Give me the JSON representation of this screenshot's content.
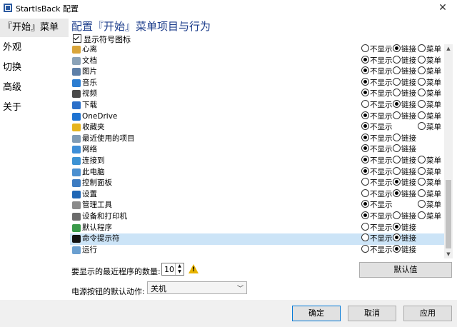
{
  "window": {
    "title": "StartIsBack 配置",
    "close": "✕"
  },
  "sidebar": {
    "items": [
      {
        "label": "『开始』菜单",
        "active": true
      },
      {
        "label": "外观",
        "active": false
      },
      {
        "label": "切换",
        "active": false
      },
      {
        "label": "高级",
        "active": false
      },
      {
        "label": "关于",
        "active": false
      }
    ]
  },
  "main": {
    "heading": "配置『开始』菜单项目与行为",
    "show_icons_label": "显示符号图标",
    "option_labels": {
      "hide": "不显示",
      "link": "链接",
      "menu": "菜单"
    },
    "items": [
      {
        "label": "心离",
        "icon": "user-icon",
        "color": "#d9a53a",
        "options": [
          "hide",
          "link",
          "menu"
        ],
        "selected": "link"
      },
      {
        "label": "文档",
        "icon": "documents-icon",
        "color": "#8aa2b8",
        "options": [
          "hide",
          "link",
          "menu"
        ],
        "selected": "hide"
      },
      {
        "label": "图片",
        "icon": "pictures-icon",
        "color": "#5d7fa8",
        "options": [
          "hide",
          "link",
          "menu"
        ],
        "selected": "hide"
      },
      {
        "label": "音乐",
        "icon": "music-icon",
        "color": "#2b7dd1",
        "options": [
          "hide",
          "link",
          "menu"
        ],
        "selected": "hide"
      },
      {
        "label": "视频",
        "icon": "video-icon",
        "color": "#4a4a4a",
        "options": [
          "hide",
          "link",
          "menu"
        ],
        "selected": "hide"
      },
      {
        "label": "下载",
        "icon": "download-icon",
        "color": "#2a6fc9",
        "options": [
          "hide",
          "link",
          "menu"
        ],
        "selected": "link"
      },
      {
        "label": "OneDrive",
        "icon": "onedrive-icon",
        "color": "#1e73d2",
        "options": [
          "hide",
          "link",
          "menu"
        ],
        "selected": "hide"
      },
      {
        "label": "收藏夹",
        "icon": "favorites-icon",
        "color": "#e6b41e",
        "options": [
          "hide",
          "menu"
        ],
        "selected": "hide"
      },
      {
        "label": "最近使用的项目",
        "icon": "recent-items-icon",
        "color": "#7f9bb5",
        "options": [
          "hide",
          "link"
        ],
        "selected": "hide"
      },
      {
        "label": "网络",
        "icon": "network-icon",
        "color": "#3d8ed8",
        "options": [
          "hide",
          "link"
        ],
        "selected": "hide"
      },
      {
        "label": "连接到",
        "icon": "connect-to-icon",
        "color": "#3c92d4",
        "options": [
          "hide",
          "link",
          "menu"
        ],
        "selected": "hide"
      },
      {
        "label": "此电脑",
        "icon": "this-pc-icon",
        "color": "#4a8fd0",
        "options": [
          "hide",
          "link",
          "menu"
        ],
        "selected": "hide"
      },
      {
        "label": "控制面板",
        "icon": "control-panel-icon",
        "color": "#3d7cc2",
        "options": [
          "hide",
          "link",
          "menu"
        ],
        "selected": "link"
      },
      {
        "label": "设置",
        "icon": "settings-icon",
        "color": "#1f66b5",
        "options": [
          "hide",
          "link",
          "menu"
        ],
        "selected": "link"
      },
      {
        "label": "管理工具",
        "icon": "admin-tools-icon",
        "color": "#8a8a8a",
        "options": [
          "hide",
          "menu"
        ],
        "selected": "hide"
      },
      {
        "label": "设备和打印机",
        "icon": "printer-icon",
        "color": "#6b6b6b",
        "options": [
          "hide",
          "link",
          "menu"
        ],
        "selected": "hide"
      },
      {
        "label": "默认程序",
        "icon": "default-programs-icon",
        "color": "#3a9a4a",
        "options": [
          "hide",
          "link"
        ],
        "selected": "link"
      },
      {
        "label": "命令提示符",
        "icon": "cmd-icon",
        "color": "#111111",
        "options": [
          "hide",
          "link"
        ],
        "selected": "link",
        "highlight": true
      },
      {
        "label": "运行",
        "icon": "run-icon",
        "color": "#6a9fd0",
        "options": [
          "hide",
          "link"
        ],
        "selected": "link"
      }
    ],
    "recent_count_label": "要显示的最近程序的数量:",
    "recent_count_value": "10",
    "default_button": "默认值",
    "power_label": "电源按钮的默认动作:",
    "power_value": "关机"
  },
  "footer": {
    "ok": "确定",
    "cancel": "取消",
    "apply": "应用"
  }
}
